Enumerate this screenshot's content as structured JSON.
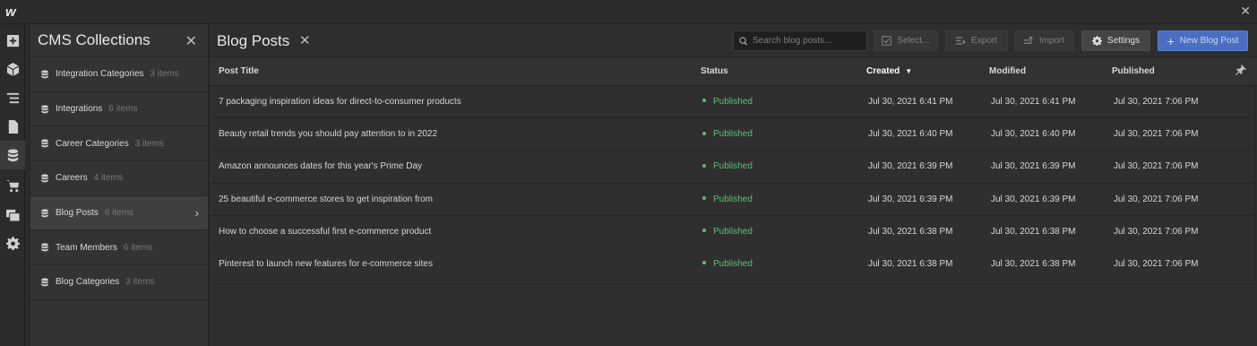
{
  "app": {
    "logo": "w"
  },
  "rail": {
    "items": [
      {
        "icon": "add-panel-icon"
      },
      {
        "icon": "box-icon"
      },
      {
        "icon": "navigator-icon"
      },
      {
        "icon": "pages-icon"
      },
      {
        "icon": "cms-database-icon",
        "active": true
      },
      {
        "icon": "ecommerce-cart-icon"
      },
      {
        "icon": "assets-icon"
      },
      {
        "icon": "settings-gear-icon"
      }
    ]
  },
  "collections": {
    "title": "CMS Collections",
    "items": [
      {
        "name": "Integration Categories",
        "count": "3 items"
      },
      {
        "name": "Integrations",
        "count": "6 items"
      },
      {
        "name": "Career Categories",
        "count": "3 items"
      },
      {
        "name": "Careers",
        "count": "4 items"
      },
      {
        "name": "Blog Posts",
        "count": "6 items",
        "active": true
      },
      {
        "name": "Team Members",
        "count": "6 items"
      },
      {
        "name": "Blog Categories",
        "count": "3 items"
      }
    ]
  },
  "main": {
    "title": "Blog Posts",
    "search": {
      "placeholder": "Search blog posts..."
    },
    "toolbar": {
      "select_label": "Select...",
      "export_label": "Export",
      "import_label": "Import",
      "settings_label": "Settings",
      "new_label": "New Blog Post"
    }
  },
  "table": {
    "columns": {
      "title": "Post Title",
      "status": "Status",
      "created": "Created",
      "modified": "Modified",
      "published": "Published"
    },
    "rows": [
      {
        "title": "7 packaging inspiration ideas for direct-to-consumer products",
        "status": "Published",
        "created": "Jul 30, 2021 6:41 PM",
        "modified": "Jul 30, 2021 6:41 PM",
        "published": "Jul 30, 2021 7:06 PM"
      },
      {
        "title": "Beauty retail trends you should pay attention to in 2022",
        "status": "Published",
        "created": "Jul 30, 2021 6:40 PM",
        "modified": "Jul 30, 2021 6:40 PM",
        "published": "Jul 30, 2021 7:06 PM"
      },
      {
        "title": "Amazon announces dates for this year's Prime Day",
        "status": "Published",
        "created": "Jul 30, 2021 6:39 PM",
        "modified": "Jul 30, 2021 6:39 PM",
        "published": "Jul 30, 2021 7:06 PM"
      },
      {
        "title": "25 beautiful e-commerce stores to get inspiration from",
        "status": "Published",
        "created": "Jul 30, 2021 6:39 PM",
        "modified": "Jul 30, 2021 6:39 PM",
        "published": "Jul 30, 2021 7:06 PM"
      },
      {
        "title": "How to choose a successful first e-commerce product",
        "status": "Published",
        "created": "Jul 30, 2021 6:38 PM",
        "modified": "Jul 30, 2021 6:38 PM",
        "published": "Jul 30, 2021 7:06 PM"
      },
      {
        "title": "Pinterest to launch new features for e-commerce sites",
        "status": "Published",
        "created": "Jul 30, 2021 6:38 PM",
        "modified": "Jul 30, 2021 6:38 PM",
        "published": "Jul 30, 2021 7:06 PM"
      }
    ]
  },
  "colors": {
    "accent": "#4a6fc0",
    "published": "#5fbf73"
  }
}
